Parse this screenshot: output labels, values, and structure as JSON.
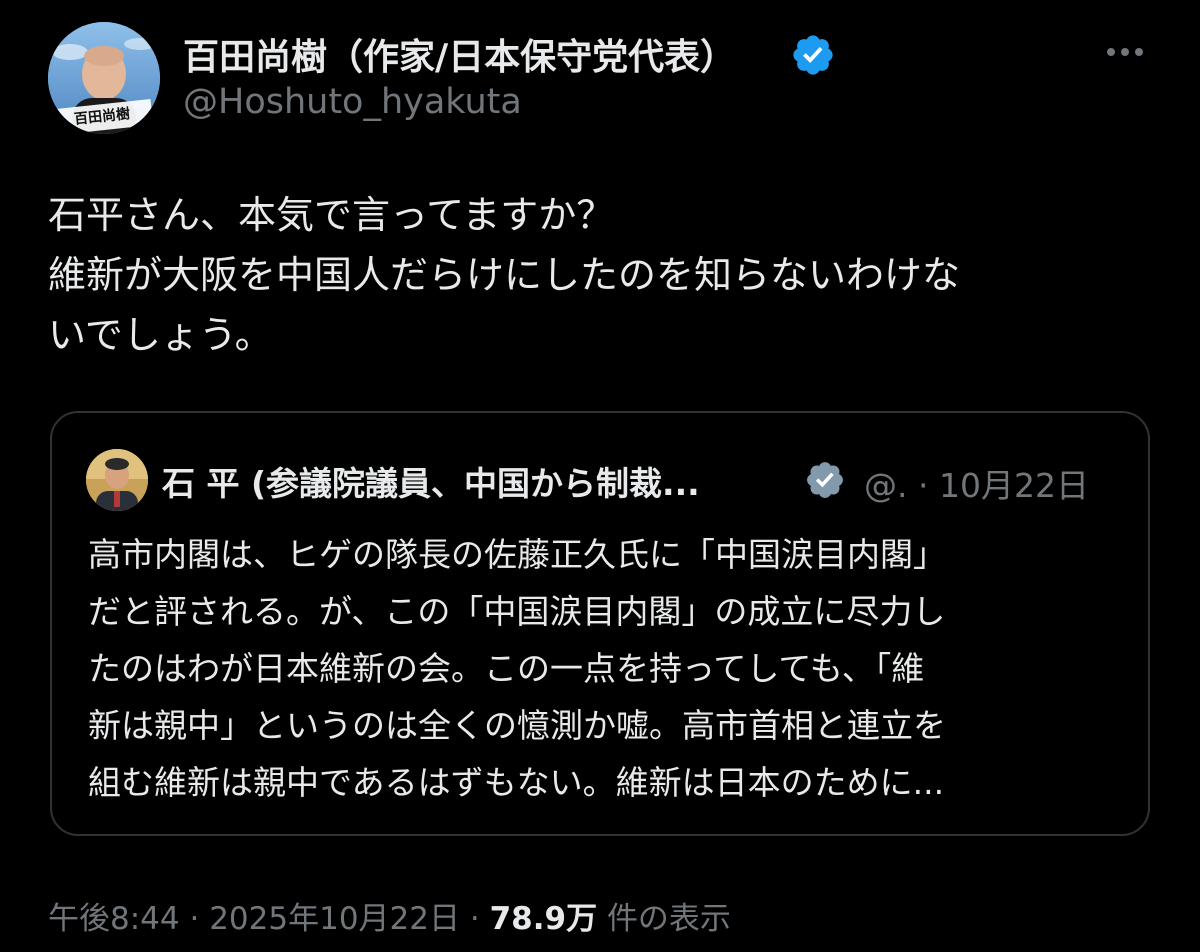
{
  "author": {
    "name": "百田尚樹（作家/日本保守党代表）",
    "handle": "@Hoshuto_hyakuta",
    "avatar_caption": "百田尚樹",
    "verified_icon": "verified-badge-icon"
  },
  "tweet": {
    "lines": [
      "石平さん、本気で言ってますか？",
      "維新が大阪を中国人だらけにしたのを知らないわけな",
      "いでしょう。"
    ]
  },
  "quote": {
    "name": "石 平 (参議院議員、中国から制裁...",
    "handle": "@.",
    "separator": "·",
    "date": "10月22日",
    "lines": [
      "高市内閣は、ヒゲの隊長の佐藤正久氏に「中国涙目内閣」",
      "だと評される。が、この「中国涙目内閣」の成立に尽力し",
      "たのはわが日本維新の会。この一点を持ってしても、「維",
      "新は親中」というのは全くの憶測か嘘。高市首相と連立を",
      "組む維新は親中であるはずもない。維新は日本のために..."
    ]
  },
  "footer": {
    "time": "午後8:44",
    "sep1": "·",
    "date": "2025年10月22日",
    "sep2": "·",
    "views_count": "78.9万",
    "views_label": "件の表示"
  },
  "colors": {
    "background": "#000000",
    "text": "#e7e9ea",
    "secondary": "#71767b",
    "verified": "#1d9bf0",
    "border": "#2f3336"
  }
}
